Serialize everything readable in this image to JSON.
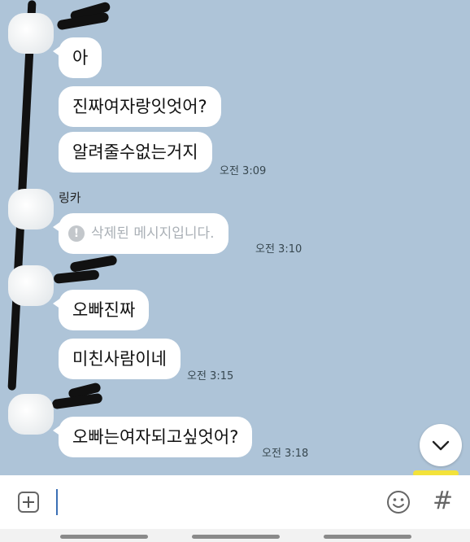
{
  "chat": {
    "messages": [
      {
        "text": "아"
      },
      {
        "text": "진짜여자랑잇엇어?"
      },
      {
        "text": "알려줄수없는거지",
        "time": "오전 3:09"
      },
      {
        "sender": "링카",
        "text": "삭제된 메시지입니다.",
        "deleted": true,
        "time": "오전 3:10"
      },
      {
        "text": "오빠진짜"
      },
      {
        "text": "미친사람이네",
        "time": "오전 3:15"
      },
      {
        "text": "오빠는여자되고싶엇어?",
        "time": "오전 3:18"
      }
    ]
  },
  "input": {
    "plus_icon": "plus-icon",
    "emoji_icon": "emoji-icon",
    "hash_label": "#"
  },
  "scroll_button": {
    "icon": "chevron-down-icon"
  },
  "colors": {
    "background": "#aec4d8",
    "bubble": "#ffffff",
    "accent_yellow": "#f3e23a"
  }
}
